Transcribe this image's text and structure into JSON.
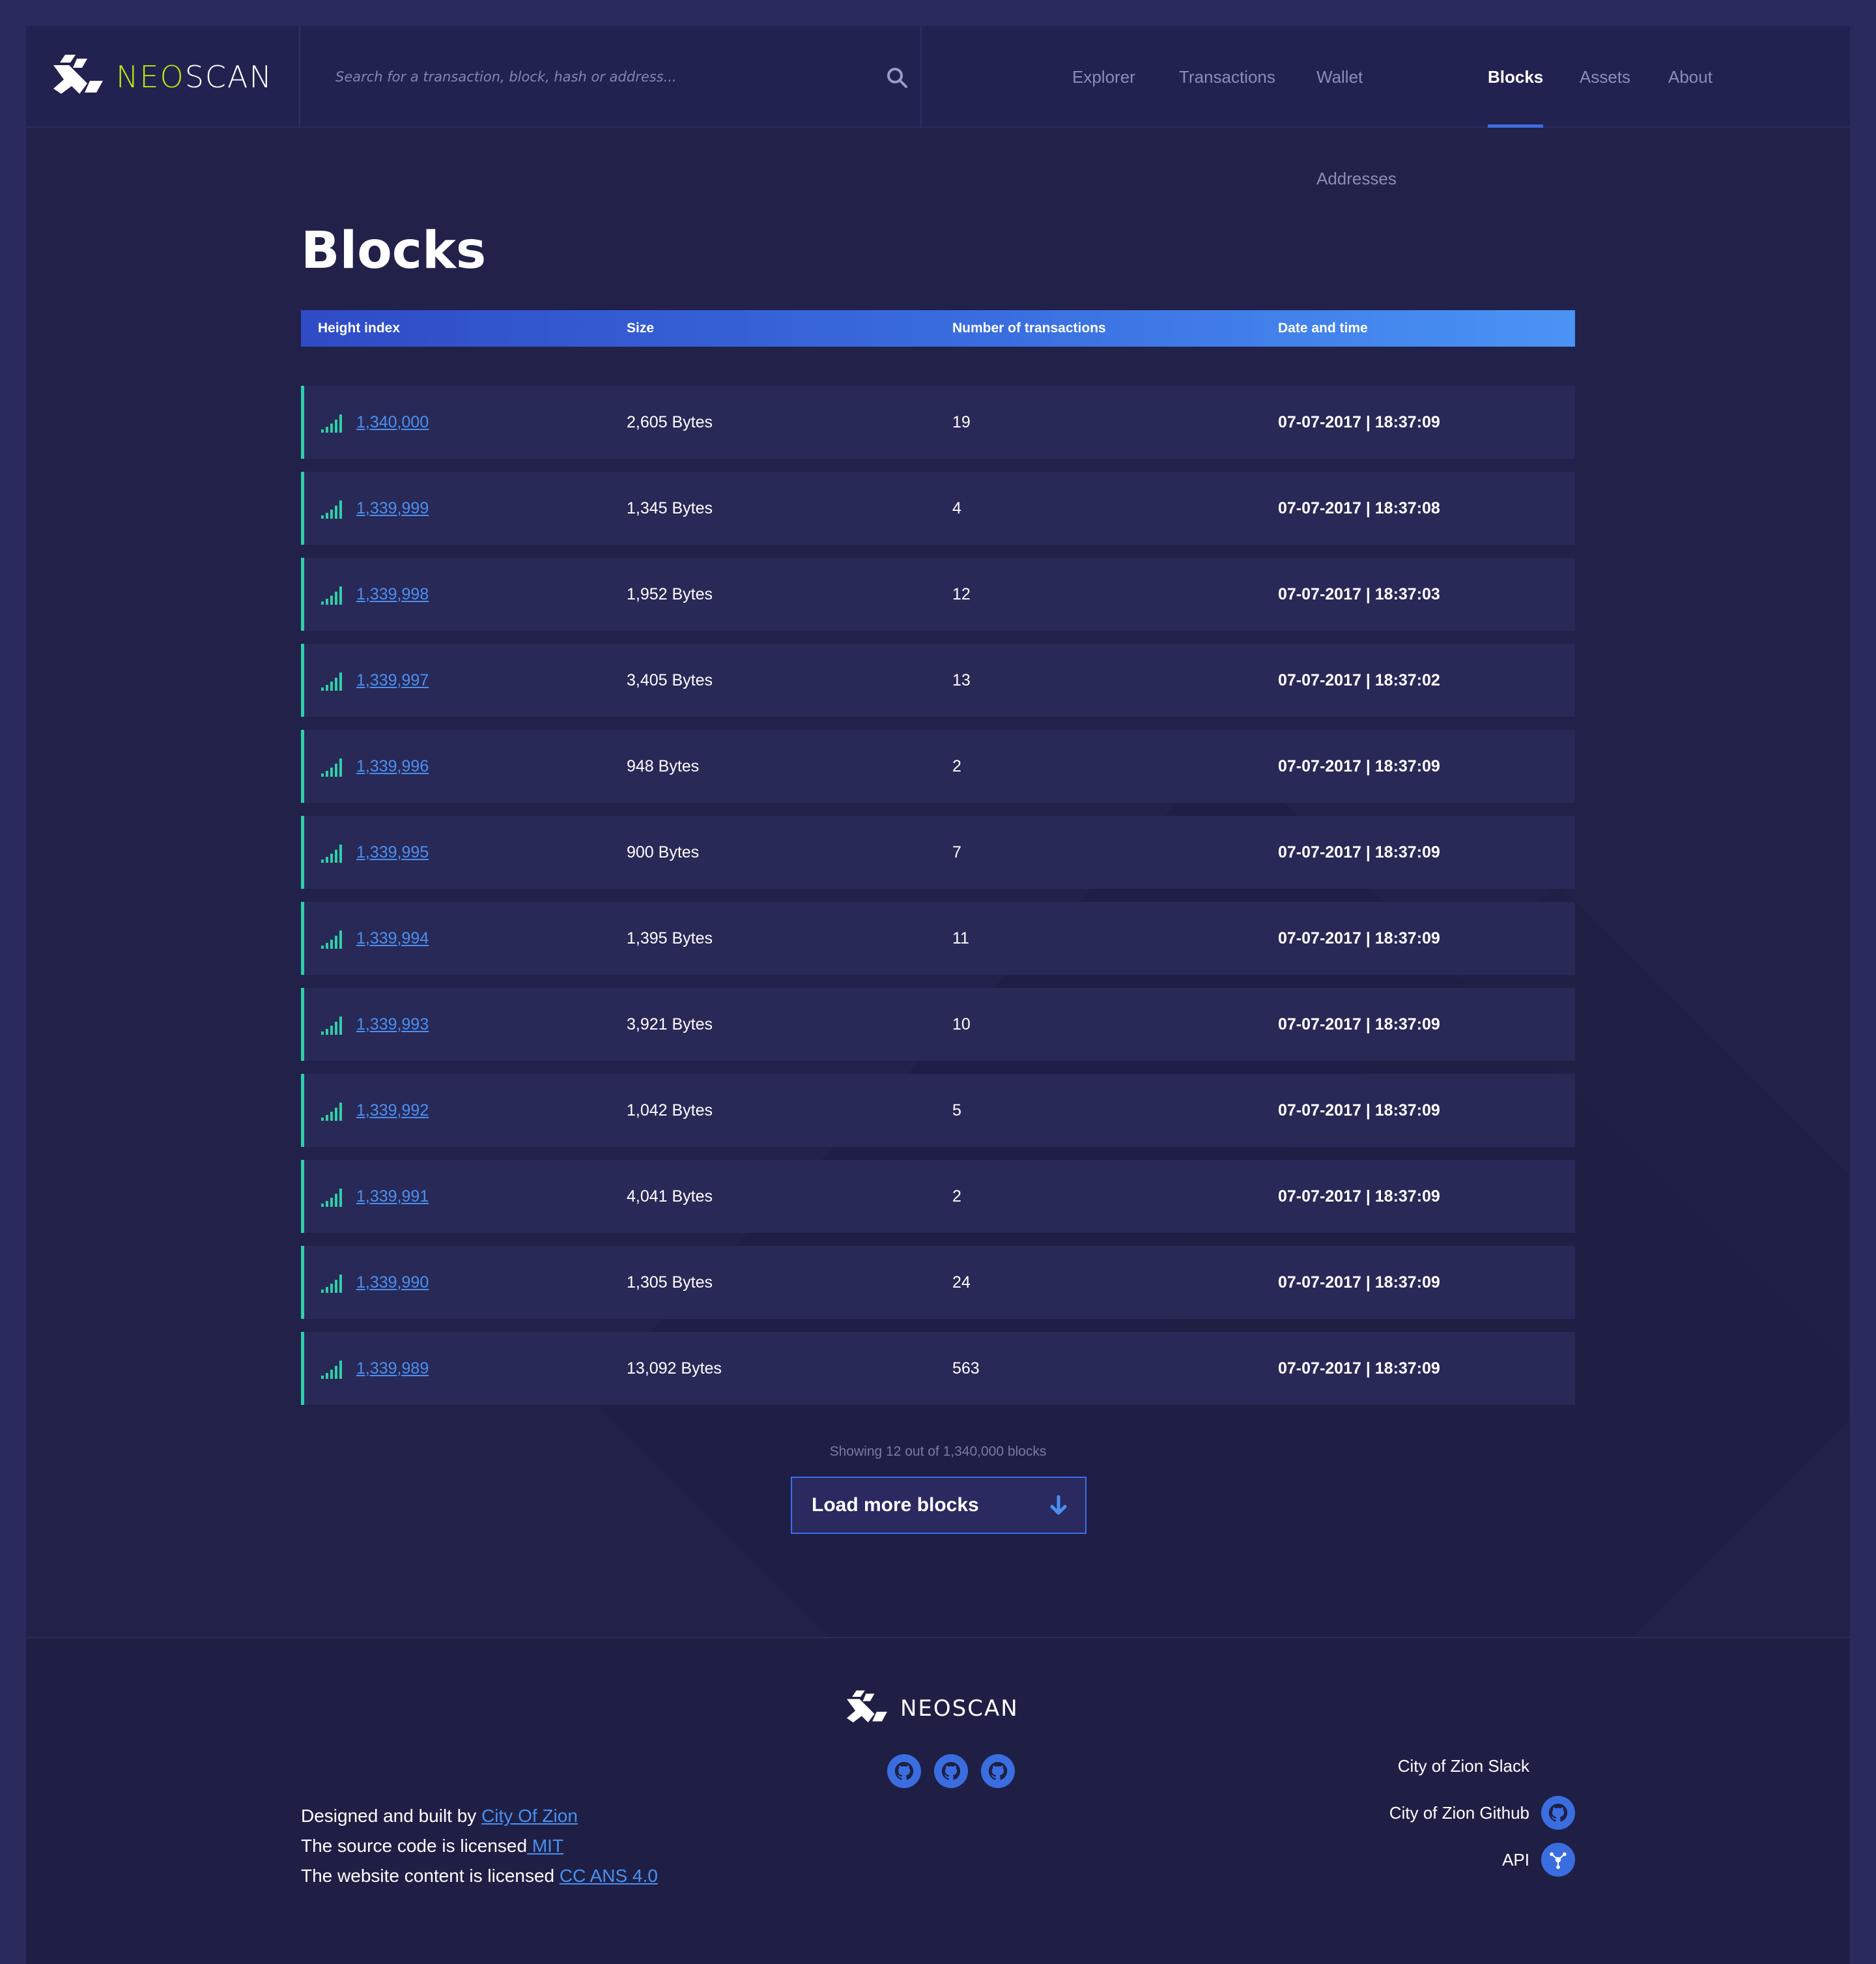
{
  "header": {
    "logo_neo": "NEO",
    "logo_scan": "SCAN",
    "search_placeholder": "Search for a transaction, block, hash or address...",
    "nav": [
      {
        "label": "Explorer",
        "active": false
      },
      {
        "label": "Transactions",
        "active": false
      },
      {
        "label": "Wallet Addresses",
        "active": false
      },
      {
        "label": "Blocks",
        "active": true
      },
      {
        "label": "Assets",
        "active": false
      },
      {
        "label": "About",
        "active": false
      }
    ]
  },
  "main": {
    "title": "Blocks",
    "columns": [
      "Height index",
      "Size",
      "Number of transactions",
      "Date and time"
    ],
    "rows": [
      {
        "height": "1,340,000",
        "size": "2,605 Bytes",
        "txs": "19",
        "date": "07-07-2017 | 18:37:09"
      },
      {
        "height": "1,339,999",
        "size": "1,345 Bytes",
        "txs": "4",
        "date": "07-07-2017 | 18:37:08"
      },
      {
        "height": "1,339,998",
        "size": "1,952 Bytes",
        "txs": "12",
        "date": "07-07-2017 | 18:37:03"
      },
      {
        "height": "1,339,997",
        "size": "3,405 Bytes",
        "txs": "13",
        "date": "07-07-2017 | 18:37:02"
      },
      {
        "height": "1,339,996",
        "size": "948 Bytes",
        "txs": "2",
        "date": "07-07-2017 | 18:37:09"
      },
      {
        "height": "1,339,995",
        "size": "900 Bytes",
        "txs": "7",
        "date": "07-07-2017 | 18:37:09"
      },
      {
        "height": "1,339,994",
        "size": "1,395 Bytes",
        "txs": "11",
        "date": "07-07-2017 | 18:37:09"
      },
      {
        "height": "1,339,993",
        "size": "3,921 Bytes",
        "txs": "10",
        "date": "07-07-2017 | 18:37:09"
      },
      {
        "height": "1,339,992",
        "size": "1,042 Bytes",
        "txs": "5",
        "date": "07-07-2017 | 18:37:09"
      },
      {
        "height": "1,339,991",
        "size": "4,041 Bytes",
        "txs": "2",
        "date": "07-07-2017 | 18:37:09"
      },
      {
        "height": "1,339,990",
        "size": "1,305 Bytes",
        "txs": "24",
        "date": "07-07-2017 | 18:37:09"
      },
      {
        "height": "1,339,989",
        "size": "13,092 Bytes",
        "txs": "563",
        "date": "07-07-2017 | 18:37:09"
      }
    ],
    "showing": "Showing 12 out of 1,340,000 blocks",
    "load_more": "Load more blocks"
  },
  "footer": {
    "logo_text": "NEOSCAN",
    "designed_prefix": "Designed and built by ",
    "designed_link": "City Of Zion",
    "source_prefix": "The source code is licensed",
    "source_link": " MIT",
    "content_prefix": "The website content is licensed ",
    "content_link": "CC ANS 4.0",
    "links": [
      "City of Zion Slack",
      "City of Zion Github",
      "API"
    ],
    "icons": [
      "github-icon",
      "github-icon",
      "github-icon"
    ]
  },
  "colors": {
    "accent": "#3b6fe0",
    "logo_green": "#b9e80e",
    "row_marker": "#2ecfa8",
    "link": "#4a90f0"
  }
}
